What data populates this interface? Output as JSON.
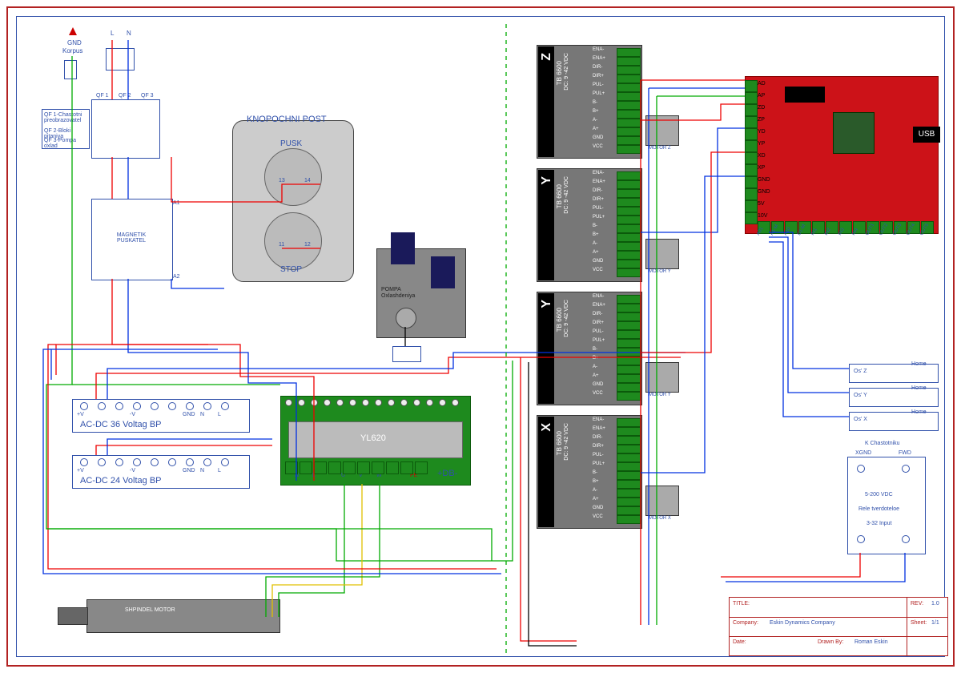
{
  "header": {
    "gnd": "GND",
    "korpus": "Korpus",
    "L": "L",
    "N": "N"
  },
  "breakers": {
    "qf1": "QF 1",
    "qf2": "QF 2",
    "qf3": "QF 3",
    "desc1": "QF 1-Chastotni preobrazovatel",
    "desc2": "QF 2-Bloki pitaniya",
    "desc3": "QF 3-Pompa oxlad"
  },
  "puskatel": {
    "title": "MAGNETIK PUSKATEL",
    "a1": "A1",
    "a2": "A2"
  },
  "post": {
    "title": "KNOPOCHNI POST",
    "pusk": "PUSK",
    "stop": "STOP",
    "t13": "13",
    "t14": "14",
    "t11": "11",
    "t12": "12"
  },
  "pump": {
    "title": "POMPA Oxlashdeniya"
  },
  "psu": [
    {
      "label": "AC-DC  36 Voltag BP",
      "plusV": "+V",
      "minusV": "-V",
      "gnd": "GND",
      "N": "N",
      "L": "L"
    },
    {
      "label": "AC-DC  24 Voltag BP",
      "plusV": "+V",
      "minusV": "-V",
      "gnd": "GND",
      "N": "N",
      "L": "L"
    }
  ],
  "vfd": {
    "model": "YL620",
    "N": "N",
    "L": "L",
    "U": "U",
    "V": "V",
    "W": "W",
    "pe": "PE",
    "db": "+DB-"
  },
  "spindle": {
    "label": "SHPINDEL MOTOR"
  },
  "drivers": [
    {
      "axis": "Z",
      "model": "TB 6600",
      "vdc": "DC: 9 -42 VDC",
      "motor": "MOTOR Z"
    },
    {
      "axis": "Y",
      "model": "TB 6600",
      "vdc": "DC: 9 -42 VDC",
      "motor": "MOTOR Y"
    },
    {
      "axis": "Y",
      "model": "TB 6600",
      "vdc": "DC: 9 -42 VDC",
      "motor": "MOTOR Y"
    },
    {
      "axis": "X",
      "model": "TB 6600",
      "vdc": "DC: 9 -42 VDC",
      "motor": "MOTOR X"
    }
  ],
  "driver_pins": [
    "ENA-",
    "ENA+",
    "DIR-",
    "DIR+",
    "PUL-",
    "PUL+",
    "B-",
    "B+",
    "A-",
    "A+",
    "GND",
    "VCC"
  ],
  "homes": [
    {
      "axis": "Os' Z",
      "lbl": "Home"
    },
    {
      "axis": "Os' Y",
      "lbl": "Home"
    },
    {
      "axis": "Os' X",
      "lbl": "Home"
    }
  ],
  "ssr": {
    "k": "K Chastotniku",
    "xgnd": "XGND",
    "fwd": "FWD",
    "v": "5-200 VDC",
    "name": "Rele tverdoteloe",
    "in": "3-32 Input"
  },
  "usb": "USB",
  "ctrl_left": [
    "AD",
    "AP",
    "ZD",
    "ZP",
    "YD",
    "YP",
    "XD",
    "XP",
    "GND",
    "GND",
    "5V",
    "10V"
  ],
  "ctrl_bot": [
    "A01",
    "A1-M",
    "A10",
    "D1-M",
    "IN1",
    "IN2",
    "IN3",
    "IN4",
    "OUT1",
    "OUT2",
    "OUT3",
    "OUT4",
    "OUT5"
  ],
  "titleblock": {
    "title_lbl": "TITLE:",
    "rev_lbl": "REV:",
    "rev": "1.0",
    "company_lbl": "Company:",
    "company": "Eskin Dynamics Company",
    "sheet_lbl": "Sheet:",
    "sheet": "1/1",
    "date_lbl": "Date:",
    "drawn_lbl": "Drawn By:",
    "drawn": "Roman Eskin"
  }
}
